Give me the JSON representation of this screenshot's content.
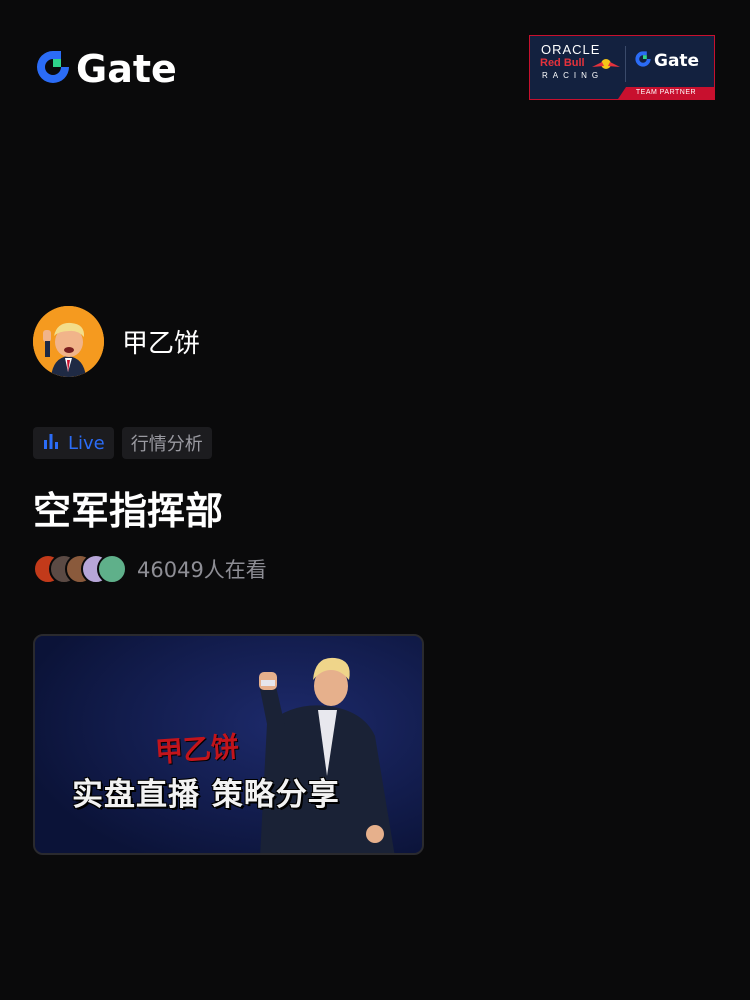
{
  "brand": {
    "name": "Gate",
    "accent_color": "#2b6cf6",
    "logo_icon": "gate-logo-icon"
  },
  "partner_badge": {
    "oracle": "ORACLE",
    "red_bull": "Red Bull",
    "racing": "RACING",
    "gate": "Gate",
    "team_partner": "TEAM PARTNER"
  },
  "streamer": {
    "name": "甲乙饼",
    "avatar_icon": "streamer-avatar"
  },
  "tags": {
    "live_label": "Live",
    "live_icon": "bar-chart-icon",
    "category_label": "行情分析"
  },
  "stream": {
    "title": "空军指挥部",
    "viewer_count_text": "46049人在看"
  },
  "thumbnail": {
    "name_overlay": "甲乙饼",
    "slogan": "实盘直播  策略分享"
  }
}
